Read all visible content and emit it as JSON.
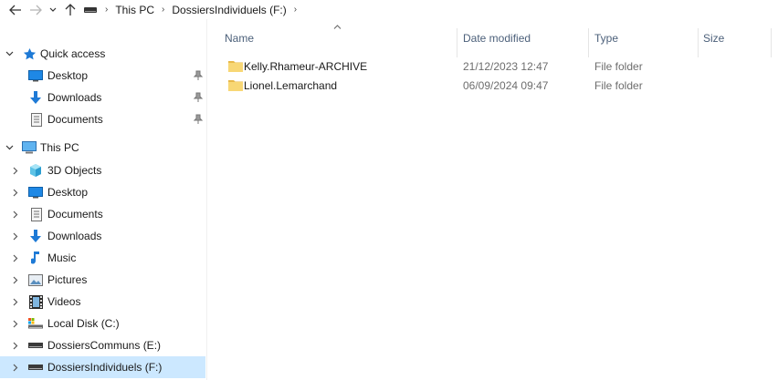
{
  "address_bar": {
    "breadcrumbs": [
      "This PC",
      "DossiersIndividuels (F:)"
    ]
  },
  "sidebar": {
    "quick_access": {
      "label": "Quick access",
      "items": [
        {
          "label": "Desktop",
          "icon": "desktop-icon",
          "pinned": true
        },
        {
          "label": "Downloads",
          "icon": "downloads-icon",
          "pinned": true
        },
        {
          "label": "Documents",
          "icon": "documents-icon",
          "pinned": true
        }
      ]
    },
    "this_pc": {
      "label": "This PC",
      "items": [
        {
          "label": "3D Objects",
          "icon": "3d-objects-icon"
        },
        {
          "label": "Desktop",
          "icon": "desktop-icon"
        },
        {
          "label": "Documents",
          "icon": "documents-icon"
        },
        {
          "label": "Downloads",
          "icon": "downloads-icon"
        },
        {
          "label": "Music",
          "icon": "music-icon"
        },
        {
          "label": "Pictures",
          "icon": "pictures-icon"
        },
        {
          "label": "Videos",
          "icon": "videos-icon"
        },
        {
          "label": "Local Disk (C:)",
          "icon": "local-disk-icon"
        },
        {
          "label": "DossiersCommuns (E:)",
          "icon": "drive-icon"
        },
        {
          "label": "DossiersIndividuels (F:)",
          "icon": "drive-icon",
          "selected": true
        }
      ]
    }
  },
  "file_list": {
    "columns": [
      "Name",
      "Date modified",
      "Type",
      "Size"
    ],
    "rows": [
      {
        "name": "Kelly.Rhameur-ARCHIVE",
        "date": "21/12/2023 12:47",
        "type": "File folder",
        "size": ""
      },
      {
        "name": "Lionel.Lemarchand",
        "date": "06/09/2024 09:47",
        "type": "File folder",
        "size": ""
      }
    ]
  },
  "colors": {
    "selected_bg": "#cce8ff",
    "folder_yellow": "#f8d775",
    "header_text": "#4c607a",
    "accent_blue": "#1e7ad6"
  }
}
